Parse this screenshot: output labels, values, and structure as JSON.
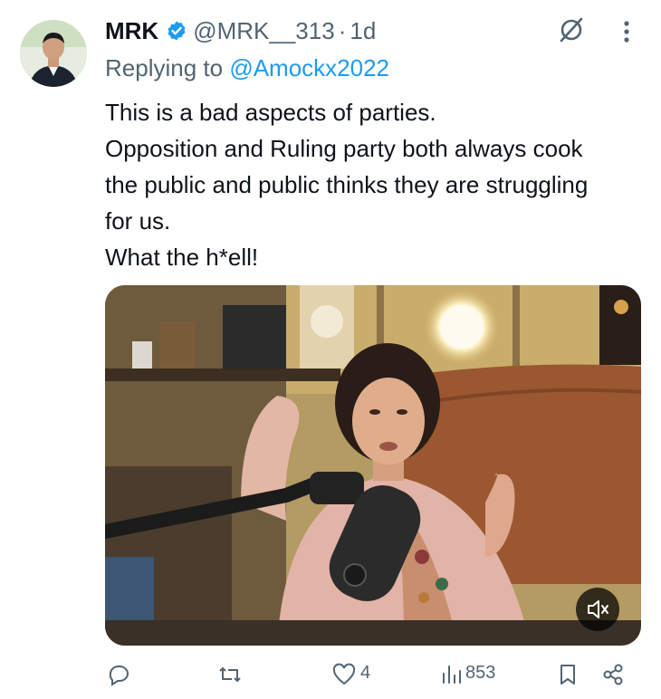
{
  "author": {
    "name": "MRK",
    "handle": "@MRK__313",
    "separator": "·",
    "time": "1d",
    "avatar_icon": "profile-photo"
  },
  "reply": {
    "prefix": "Replying to ",
    "mention": "@Amockx2022"
  },
  "tweet": {
    "lines": [
      "This is a bad aspects of parties.",
      "Opposition and Ruling party both always cook",
      "the public and public thinks they are struggling",
      "for us.",
      "What the h*ell!"
    ]
  },
  "media": {
    "type": "video",
    "mute_icon": "speaker-muted-icon"
  },
  "actions": {
    "reply_count": "",
    "repost_count": "",
    "like_count": "4",
    "views_count": "853"
  },
  "colors": {
    "accent": "#1d9bf0",
    "secondary_text": "#536471",
    "primary_text": "#0f1419"
  }
}
